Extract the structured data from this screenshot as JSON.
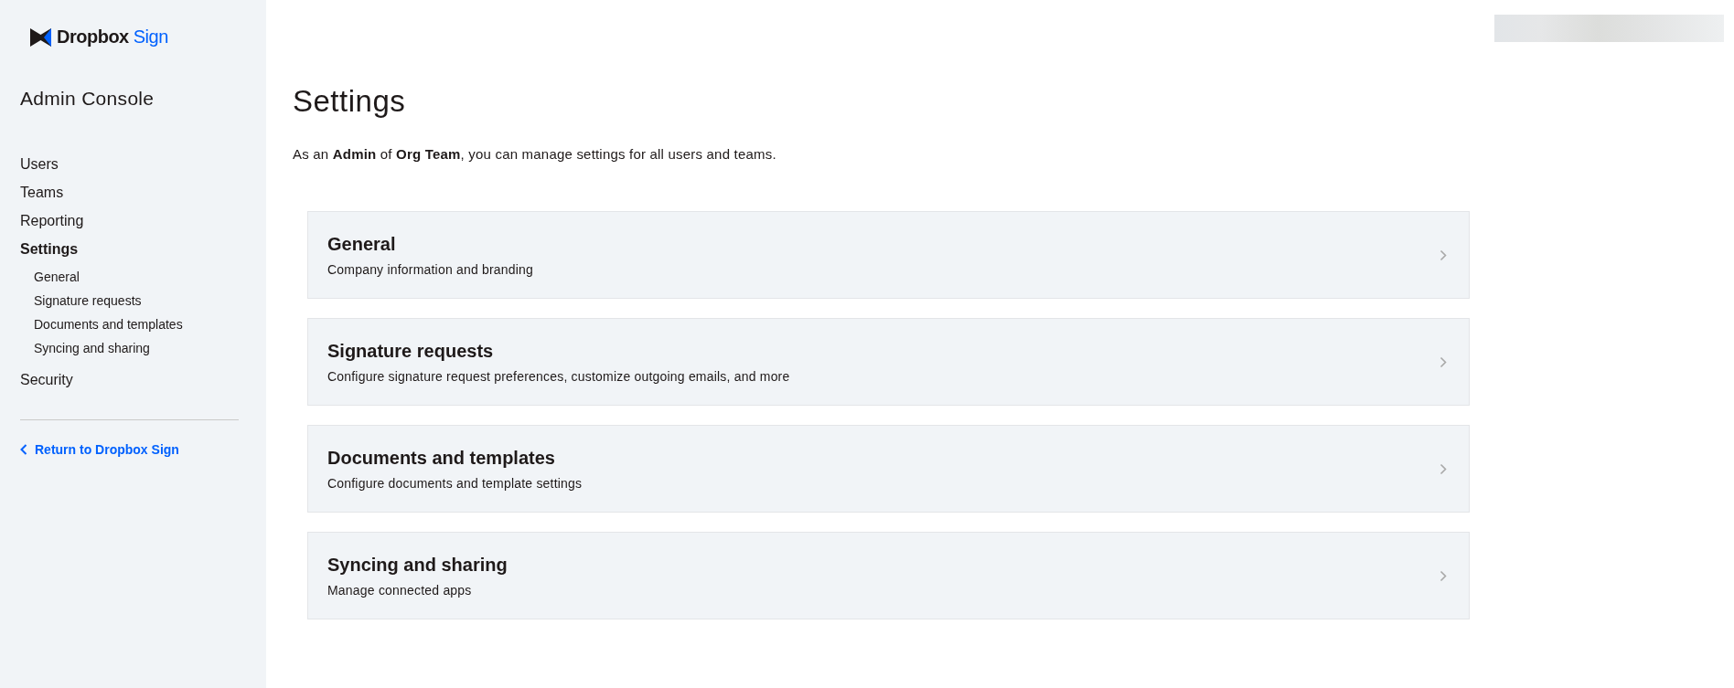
{
  "sidebar": {
    "logo": {
      "brand": "Dropbox",
      "product": "Sign"
    },
    "title": "Admin Console",
    "items": [
      {
        "label": "Users",
        "selected": false
      },
      {
        "label": "Teams",
        "selected": false
      },
      {
        "label": "Reporting",
        "selected": false
      },
      {
        "label": "Settings",
        "selected": true,
        "children": [
          {
            "label": "General"
          },
          {
            "label": "Signature requests"
          },
          {
            "label": "Documents and templates"
          },
          {
            "label": "Syncing and sharing"
          }
        ]
      },
      {
        "label": "Security",
        "selected": false
      }
    ],
    "return_link": "Return to Dropbox Sign"
  },
  "header": {
    "account": {
      "kind": "redacted"
    }
  },
  "page": {
    "title": "Settings",
    "intro": "As an **Admin** of **Org Team**, you can manage settings for all users and teams.",
    "cards": [
      {
        "title": "General",
        "description": "Company information and branding"
      },
      {
        "title": "Signature requests",
        "description": "Configure signature request preferences, customize outgoing emails, and more"
      },
      {
        "title": "Documents and templates",
        "description": "Configure documents and template settings"
      },
      {
        "title": "Syncing and sharing",
        "description": "Manage connected apps"
      }
    ]
  }
}
